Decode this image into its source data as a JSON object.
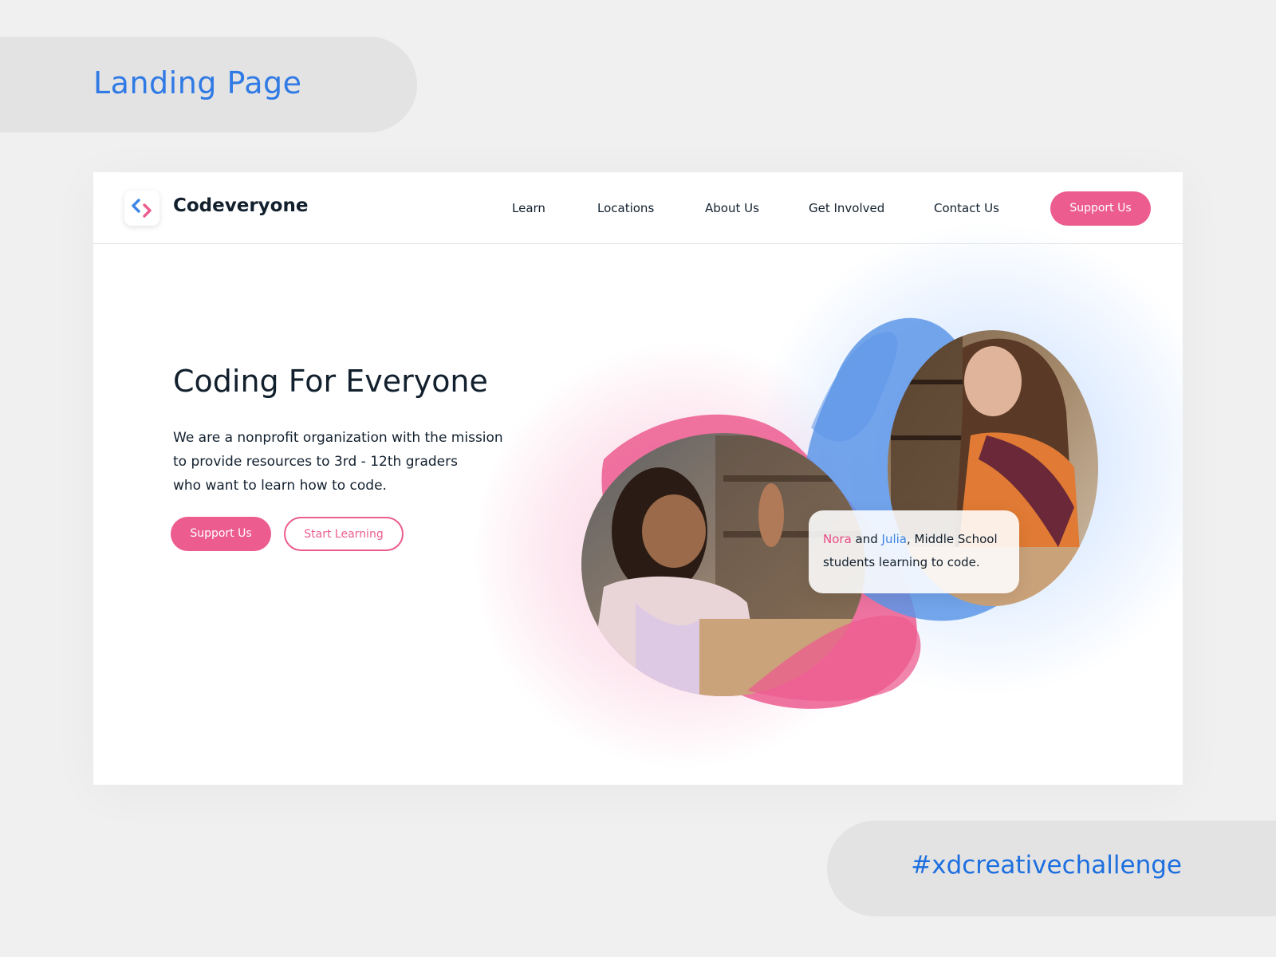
{
  "header_pill": {
    "text": "Landing Page"
  },
  "footer_pill": {
    "text": "#xdcreativechallenge"
  },
  "brand": {
    "name": "Codeveryone",
    "icon": "code-brackets-icon"
  },
  "nav": {
    "items": [
      {
        "label": "Learn"
      },
      {
        "label": "Locations"
      },
      {
        "label": "About Us"
      },
      {
        "label": "Get Involved"
      },
      {
        "label": "Contact Us"
      }
    ],
    "cta_label": "Support Us"
  },
  "hero": {
    "title": "Coding For Everyone",
    "description_lines": [
      "We are a nonprofit organization with the mission",
      "to provide resources to 3rd - 12th graders",
      "who want to learn how to code."
    ],
    "primary_button": "Support Us",
    "secondary_button": "Start Learning"
  },
  "caption": {
    "name1": "Nora",
    "and": " and ",
    "name2": "Julia",
    "line1_rest": ", Middle School",
    "line2": "students learning to code."
  },
  "colors": {
    "accent_pink": "#ec5c8f",
    "accent_blue": "#2f7ae5",
    "text_dark": "#12202e",
    "page_bg": "#f0f0f0"
  }
}
